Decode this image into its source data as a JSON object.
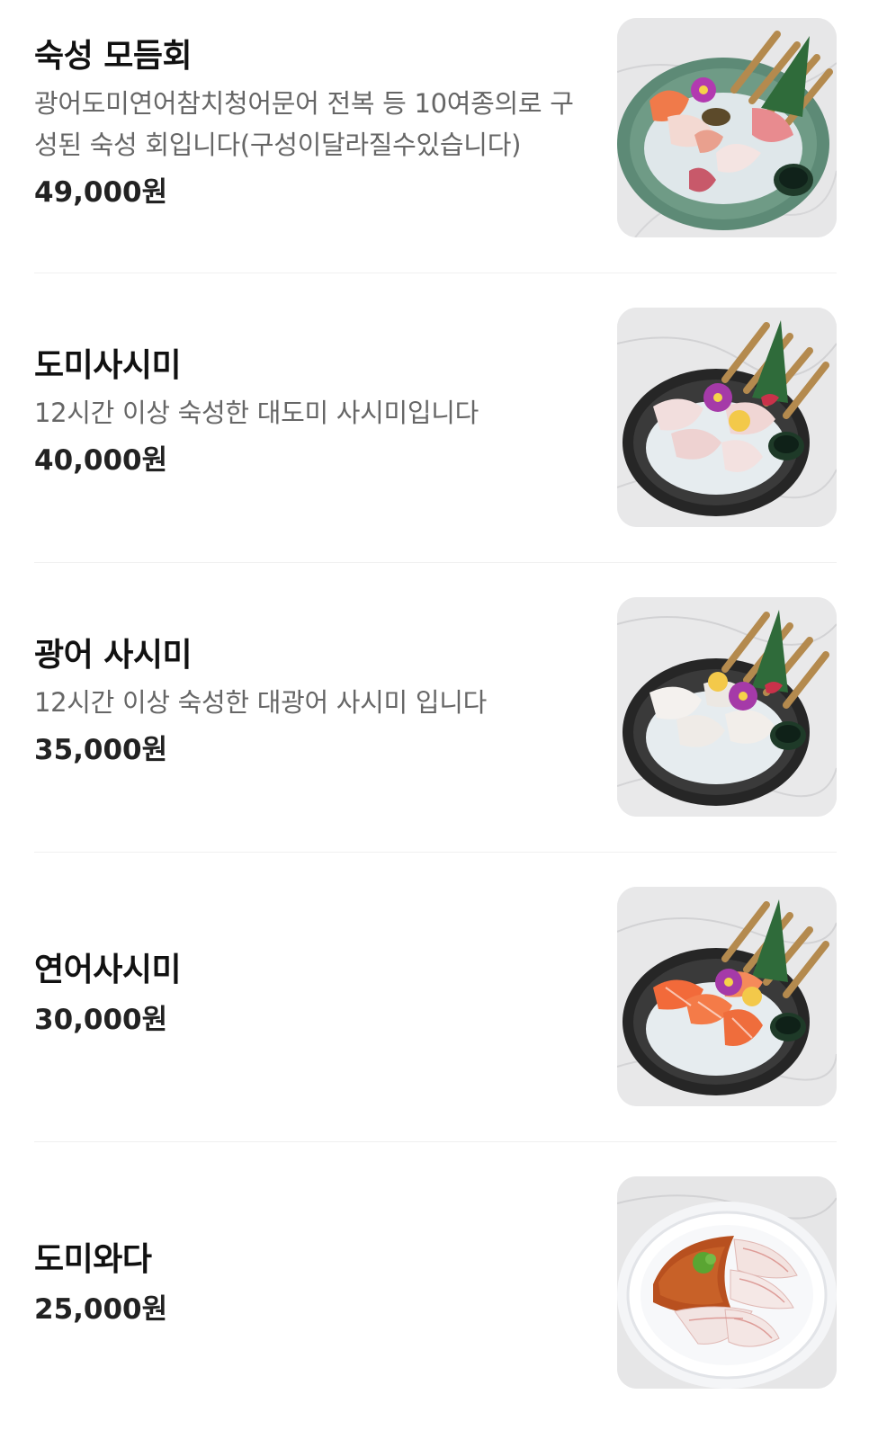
{
  "menu": {
    "items": [
      {
        "name": "숙성 모듬회",
        "description": "광어도미연어참치청어문어 전복 등 10여종의로 구성된 숙성 회입니다(구성이달라질수있습니다)",
        "price": "49,000원",
        "image_icon": "assorted-sashimi-photo"
      },
      {
        "name": "도미사시미",
        "description": "12시간 이상 숙성한 대도미 사시미입니다",
        "price": "40,000원",
        "image_icon": "sea-bream-sashimi-photo"
      },
      {
        "name": "광어 사시미",
        "description": "12시간 이상 숙성한 대광어 사시미 입니다",
        "price": "35,000원",
        "image_icon": "flatfish-sashimi-photo"
      },
      {
        "name": "연어사시미",
        "description": "",
        "price": "30,000원",
        "image_icon": "salmon-sashimi-photo"
      },
      {
        "name": "도미와다",
        "description": "",
        "price": "25,000원",
        "image_icon": "sea-bream-wada-photo"
      }
    ]
  },
  "colors": {
    "name_text": "#111111",
    "description_text": "#666666",
    "price_text": "#222222",
    "divider": "#f0f0f0",
    "background": "#ffffff"
  }
}
